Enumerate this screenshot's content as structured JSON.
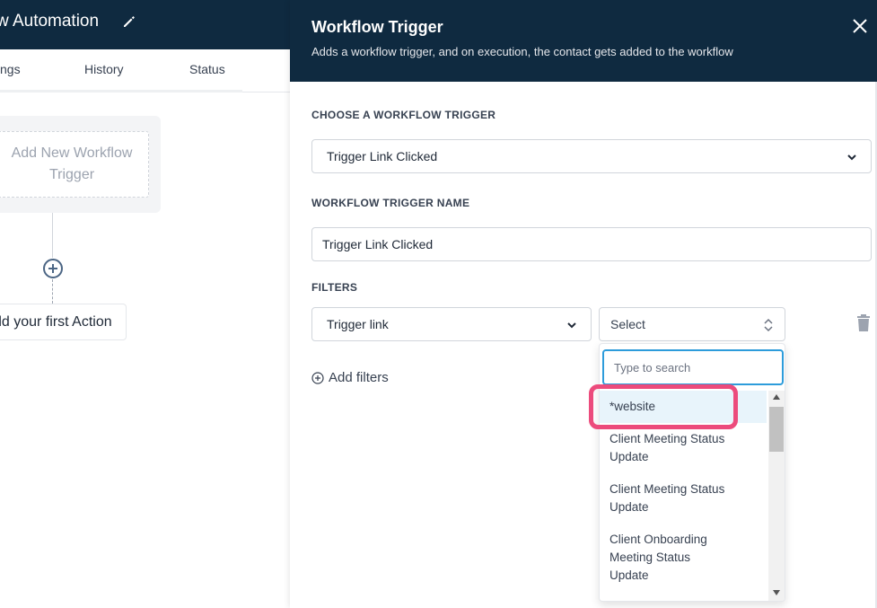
{
  "app": {
    "title": "w Automation",
    "tabs": [
      "ngs",
      "History",
      "Status"
    ]
  },
  "canvas": {
    "trigger_placeholder": "Add New Workflow Trigger",
    "first_action": "dd your first Action"
  },
  "panel": {
    "title": "Workflow Trigger",
    "subtitle": "Adds a workflow trigger, and on execution, the contact gets added to the workflow",
    "trigger_label": "CHOOSE A WORKFLOW TRIGGER",
    "trigger_value": "Trigger Link Clicked",
    "name_label": "WORKFLOW TRIGGER NAME",
    "name_value": "Trigger Link Clicked",
    "filters_label": "FILTERS",
    "filter_field": "Trigger link",
    "filter_value": "Select",
    "add_filters": "Add filters"
  },
  "dropdown": {
    "search_placeholder": "Type to search",
    "options": [
      "*website",
      "Client Meeting Status Update",
      "Client Meeting Status Update",
      "Client Onboarding Meeting Status Update"
    ]
  },
  "colors": {
    "header_bg": "#0f2a40",
    "accent": "#2d9cdb",
    "highlight": "#ec4b7c"
  }
}
